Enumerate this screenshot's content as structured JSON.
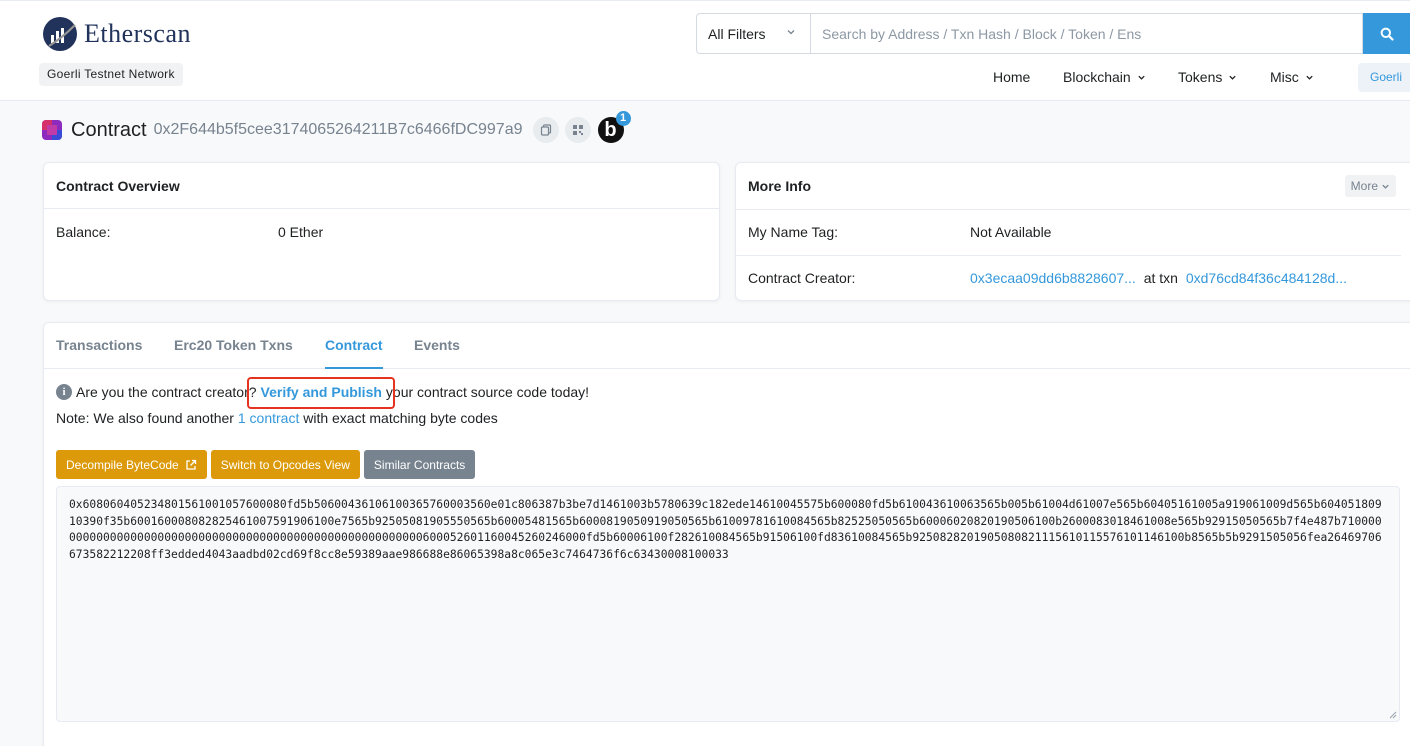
{
  "brand": {
    "name": "Etherscan",
    "network": "Goerli Testnet Network"
  },
  "search": {
    "filter_label": "All Filters",
    "placeholder": "Search by Address / Txn Hash / Block / Token / Ens"
  },
  "nav": {
    "items": [
      {
        "label": "Home"
      },
      {
        "label": "Blockchain"
      },
      {
        "label": "Tokens"
      },
      {
        "label": "Misc"
      }
    ],
    "network_button": "Goerli"
  },
  "contract": {
    "title": "Contract",
    "address": "0x2F644b5f5cee3174065264211B7c6466fDC997a9",
    "blockscan_badge": "1"
  },
  "overview": {
    "heading": "Contract Overview",
    "balance_label": "Balance:",
    "balance_value": "0 Ether"
  },
  "more_info": {
    "heading": "More Info",
    "more_button": "More",
    "name_tag_label": "My Name Tag:",
    "name_tag_value": "Not Available",
    "creator_label": "Contract Creator:",
    "creator_address": "0x3ecaa09dd6b8828607...",
    "at_txn_label": "at txn",
    "creator_txn": "0xd76cd84f36c484128d..."
  },
  "tabs": [
    {
      "label": "Transactions"
    },
    {
      "label": "Erc20 Token Txns"
    },
    {
      "label": "Contract",
      "active": true
    },
    {
      "label": "Events"
    }
  ],
  "contract_tab": {
    "info_icon": "i",
    "notice_prefix": "Are you the contract creator?",
    "verify_link": "Verify and Publish",
    "notice_suffix": "your contract source code today!",
    "note_prefix": "Note: We also found another",
    "note_link": "1 contract",
    "note_suffix": "with exact matching byte codes",
    "buttons": {
      "decompile": "Decompile ByteCode",
      "opcodes": "Switch to Opcodes View",
      "similar": "Similar Contracts"
    },
    "bytecode": "0x608060405234801561001057600080fd5b5060043610610036576000356 0e01c806387b3be7d1461003b5780639c182ede14610045575b600080fd5b610043610063565b005b61004d61007e565b60405161005a919061009d565b60405180910390f35b6001600080828254610075919061 00e7565b92505081905550565b60005481565b60008190509190505 65b61009781610084565b82525050565b60006020820190506100b2600083018461008e565b92915050565b7f4e487b71000000000000000000000000000000000000000000000000000000006000 52601160045260246000fd5b60006100f282610084565b91506100fd83610084565b9250828201905080821115610115576101146100b8565b5b9291505056fea26469706673582212208ff3edded4043aadbd02cd69f8cc8e59389aae986688e86065398a8c065e3c7464736f6c63430008100033"
  },
  "colors": {
    "accent": "#3498db",
    "warning_button": "#dc9a0a",
    "secondary_button": "#77838f",
    "highlight_box": "#e53320"
  }
}
